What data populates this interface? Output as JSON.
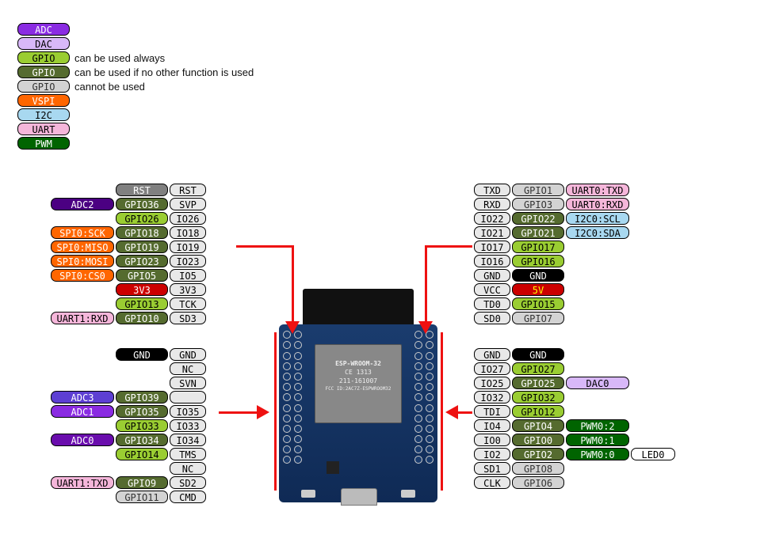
{
  "legend": [
    {
      "label": "ADC",
      "cls": "c-adc1",
      "note": ""
    },
    {
      "label": "DAC",
      "cls": "c-dac",
      "note": ""
    },
    {
      "label": "GPIO",
      "cls": "c-gpio-g",
      "note": "can be used always"
    },
    {
      "label": "GPIO",
      "cls": "c-gpio-d",
      "note": "can be used if no other function is used"
    },
    {
      "label": "GPIO",
      "cls": "c-gpio-x",
      "note": "cannot be used"
    },
    {
      "label": "VSPI",
      "cls": "c-vspi",
      "note": ""
    },
    {
      "label": "I2C",
      "cls": "c-i2c",
      "note": ""
    },
    {
      "label": "UART",
      "cls": "c-uart",
      "note": ""
    },
    {
      "label": "PWM",
      "cls": "c-pwm",
      "note": ""
    }
  ],
  "colTL": [
    {
      "extra": null,
      "second": {
        "t": "RST",
        "c": "c-rst"
      },
      "pin": "RST"
    },
    {
      "extra": {
        "t": "ADC2",
        "c": "c-adc2"
      },
      "second": {
        "t": "GPIO36",
        "c": "c-gpio-d"
      },
      "pin": "SVP"
    },
    {
      "extra": null,
      "second": {
        "t": "GPIO26",
        "c": "c-gpio-g"
      },
      "pin": "IO26"
    },
    {
      "extra": {
        "t": "SPI0:SCK",
        "c": "c-vspi"
      },
      "second": {
        "t": "GPIO18",
        "c": "c-gpio-d"
      },
      "pin": "IO18"
    },
    {
      "extra": {
        "t": "SPI0:MISO",
        "c": "c-vspi"
      },
      "second": {
        "t": "GPIO19",
        "c": "c-gpio-d"
      },
      "pin": "IO19"
    },
    {
      "extra": {
        "t": "SPI0:MOSI",
        "c": "c-vspi"
      },
      "second": {
        "t": "GPIO23",
        "c": "c-gpio-d"
      },
      "pin": "IO23"
    },
    {
      "extra": {
        "t": "SPI0:CS0",
        "c": "c-vspi"
      },
      "second": {
        "t": "GPIO5",
        "c": "c-gpio-d"
      },
      "pin": "IO5"
    },
    {
      "extra": null,
      "second": {
        "t": "3V3",
        "c": "c-3v3"
      },
      "pin": "3V3"
    },
    {
      "extra": null,
      "second": {
        "t": "GPIO13",
        "c": "c-gpio-g"
      },
      "pin": "TCK"
    },
    {
      "extra": {
        "t": "UART1:RXD",
        "c": "c-uart"
      },
      "second": {
        "t": "GPIO10",
        "c": "c-gpio-d"
      },
      "pin": "SD3"
    }
  ],
  "colTR": [
    {
      "pin": "TXD",
      "second": {
        "t": "GPIO1",
        "c": "c-gpio-x"
      },
      "extra": {
        "t": "UART0:TXD",
        "c": "c-uart"
      }
    },
    {
      "pin": "RXD",
      "second": {
        "t": "GPIO3",
        "c": "c-gpio-x"
      },
      "extra": {
        "t": "UART0:RXD",
        "c": "c-uart"
      }
    },
    {
      "pin": "IO22",
      "second": {
        "t": "GPIO22",
        "c": "c-gpio-d"
      },
      "extra": {
        "t": "I2C0:SCL",
        "c": "c-i2c"
      }
    },
    {
      "pin": "IO21",
      "second": {
        "t": "GPIO21",
        "c": "c-gpio-d"
      },
      "extra": {
        "t": "I2C0:SDA",
        "c": "c-i2c"
      }
    },
    {
      "pin": "IO17",
      "second": {
        "t": "GPIO17",
        "c": "c-gpio-g"
      },
      "extra": null
    },
    {
      "pin": "IO16",
      "second": {
        "t": "GPIO16",
        "c": "c-gpio-g"
      },
      "extra": null
    },
    {
      "pin": "GND",
      "second": {
        "t": "GND",
        "c": "c-gnd"
      },
      "extra": null
    },
    {
      "pin": "VCC",
      "second": {
        "t": "5V",
        "c": "c-5v"
      },
      "extra": null
    },
    {
      "pin": "TD0",
      "second": {
        "t": "GPIO15",
        "c": "c-gpio-g"
      },
      "extra": null
    },
    {
      "pin": "SD0",
      "second": {
        "t": "GPIO7",
        "c": "c-gpio-x"
      },
      "extra": null
    }
  ],
  "colBL": [
    {
      "extra": null,
      "second": {
        "t": "GND",
        "c": "c-gnd"
      },
      "pin": "GND"
    },
    {
      "extra": null,
      "second": null,
      "pin": "NC"
    },
    {
      "extra": null,
      "second": null,
      "pin": "SVN"
    },
    {
      "extra": {
        "t": "ADC3",
        "c": "c-adc3"
      },
      "second": {
        "t": "GPIO39",
        "c": "c-gpio-d"
      },
      "pin": ""
    },
    {
      "extra": {
        "t": "ADC1",
        "c": "c-adc1"
      },
      "second": {
        "t": "GPIO35",
        "c": "c-gpio-d"
      },
      "pin": "IO35"
    },
    {
      "extra": null,
      "second": {
        "t": "GPIO33",
        "c": "c-gpio-g"
      },
      "pin": "IO33"
    },
    {
      "extra": {
        "t": "ADC0",
        "c": "c-adc0"
      },
      "second": {
        "t": "GPIO34",
        "c": "c-gpio-d"
      },
      "pin": "IO34"
    },
    {
      "extra": null,
      "second": {
        "t": "GPIO14",
        "c": "c-gpio-g"
      },
      "pin": "TMS"
    },
    {
      "extra": null,
      "second": null,
      "pin": "NC"
    },
    {
      "extra": {
        "t": "UART1:TXD",
        "c": "c-uart"
      },
      "second": {
        "t": "GPIO9",
        "c": "c-gpio-d"
      },
      "pin": "SD2"
    },
    {
      "extra": null,
      "second": {
        "t": "GPIO11",
        "c": "c-gpio-x"
      },
      "pin": "CMD"
    }
  ],
  "colBR": [
    {
      "pin": "GND",
      "second": {
        "t": "GND",
        "c": "c-gnd"
      },
      "extra": null,
      "extra2": null
    },
    {
      "pin": "IO27",
      "second": {
        "t": "GPIO27",
        "c": "c-gpio-g"
      },
      "extra": null,
      "extra2": null
    },
    {
      "pin": "IO25",
      "second": {
        "t": "GPIO25",
        "c": "c-gpio-d"
      },
      "extra": {
        "t": "DAC0",
        "c": "c-dac"
      },
      "extra2": null
    },
    {
      "pin": "IO32",
      "second": {
        "t": "GPIO32",
        "c": "c-gpio-g"
      },
      "extra": null,
      "extra2": null
    },
    {
      "pin": "TDI",
      "second": {
        "t": "GPIO12",
        "c": "c-gpio-g"
      },
      "extra": null,
      "extra2": null
    },
    {
      "pin": "IO4",
      "second": {
        "t": "GPIO4",
        "c": "c-gpio-d"
      },
      "extra": {
        "t": "PWM0:2",
        "c": "c-pwm"
      },
      "extra2": null
    },
    {
      "pin": "IO0",
      "second": {
        "t": "GPIO0",
        "c": "c-gpio-d"
      },
      "extra": {
        "t": "PWM0:1",
        "c": "c-pwm"
      },
      "extra2": null
    },
    {
      "pin": "IO2",
      "second": {
        "t": "GPIO2",
        "c": "c-gpio-d"
      },
      "extra": {
        "t": "PWM0:0",
        "c": "c-pwm"
      },
      "extra2": {
        "t": "LED0",
        "c": "c-led"
      }
    },
    {
      "pin": "SD1",
      "second": {
        "t": "GPIO8",
        "c": "c-gpio-x"
      },
      "extra": null,
      "extra2": null
    },
    {
      "pin": "CLK",
      "second": {
        "t": "GPIO6",
        "c": "c-gpio-x"
      },
      "extra": null,
      "extra2": null
    }
  ],
  "chip": {
    "l1": "ESP-WROOM-32",
    "l2": "CE 1313",
    "l3": "211-161007",
    "l4": "FCC ID:2AC7Z-ESPWROOM32"
  }
}
